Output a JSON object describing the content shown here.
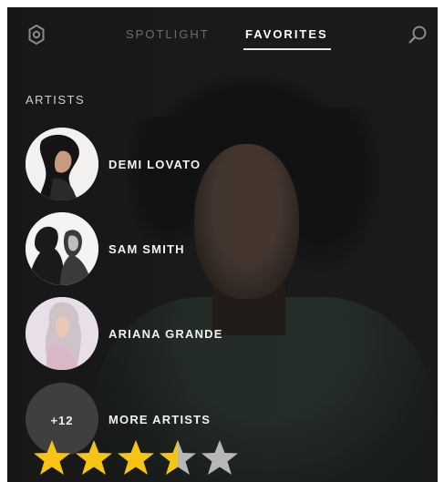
{
  "header": {
    "tabs": [
      {
        "label": "SPOTLIGHT"
      },
      {
        "label": "FAVORITES"
      }
    ],
    "active_tab": "FAVORITES",
    "left_icon": "gear-icon",
    "right_icon": "search-icon"
  },
  "section": {
    "title": "ARTISTS"
  },
  "artists": [
    {
      "name": "DEMI LOVATO"
    },
    {
      "name": "SAM SMITH"
    },
    {
      "name": "ARIANA GRANDE"
    }
  ],
  "more": {
    "count": "+12",
    "label": "MORE ARTISTS"
  },
  "rating": {
    "value": 3.5,
    "max": 5,
    "filled_color": "#f6c414",
    "empty_color": "#b7b7b7"
  }
}
